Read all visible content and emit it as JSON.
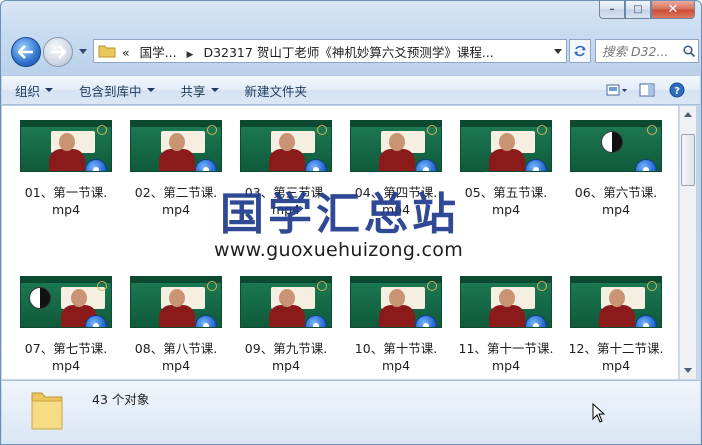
{
  "window": {
    "minimize_label": "–",
    "maximize_label": "□",
    "close_label": "✕"
  },
  "address": {
    "prefix": "«",
    "segments": [
      "国学...",
      "D32317 贺山丁老师《神机妙算六爻预测学》课程..."
    ]
  },
  "search": {
    "placeholder": "搜索 D32..."
  },
  "toolbar": {
    "items": [
      "组织",
      "包含到库中",
      "共享",
      "新建文件夹"
    ]
  },
  "files": [
    {
      "name": "01、第一节课.\nmp4"
    },
    {
      "name": "02、第二节课.\nmp4"
    },
    {
      "name": "03、第三节课.\nmp4"
    },
    {
      "name": "04、第四节课.\nmp4"
    },
    {
      "name": "05、第五节课.\nmp4"
    },
    {
      "name": "06、第六节课.\nmp4"
    },
    {
      "name": "07、第七节课.\nmp4"
    },
    {
      "name": "08、第八节课.\nmp4"
    },
    {
      "name": "09、第九节课.\nmp4"
    },
    {
      "name": "10、第十节课.\nmp4"
    },
    {
      "name": "11、第十一节课.\nmp4"
    },
    {
      "name": "12、第十二节课.\nmp4"
    }
  ],
  "watermark": {
    "title": "国学汇总站",
    "url": "www.guoxuehuizong.com"
  },
  "details": {
    "count": "43 个对象"
  },
  "colors": {
    "accent": "#2e74cf",
    "watermark": "#1f3a8c",
    "thumb_green": "#1d7c54"
  }
}
